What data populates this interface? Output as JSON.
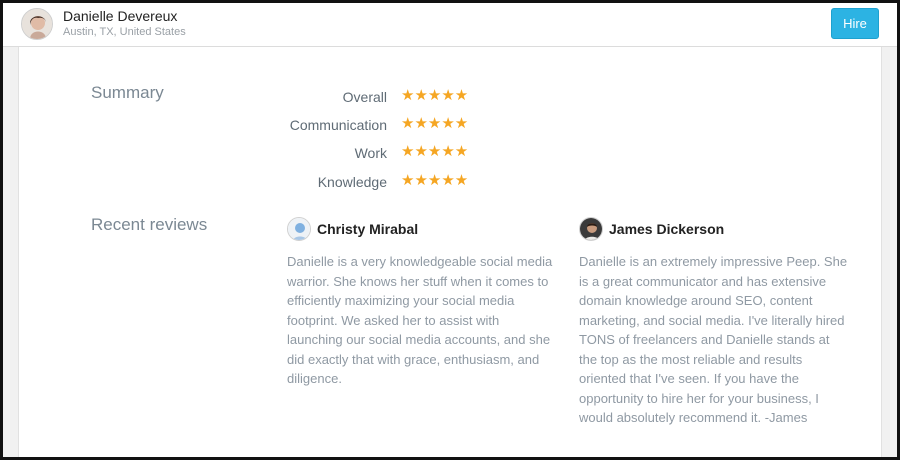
{
  "header": {
    "name": "Danielle Devereux",
    "location": "Austin, TX, United States",
    "hire_label": "Hire"
  },
  "summary": {
    "title": "Summary",
    "ratings": [
      {
        "label": "Overall",
        "stars": 5
      },
      {
        "label": "Communication",
        "stars": 5
      },
      {
        "label": "Work",
        "stars": 5
      },
      {
        "label": "Knowledge",
        "stars": 5
      }
    ],
    "star_glyph": "★★★★★",
    "star_color": "#f5a623"
  },
  "reviews": {
    "title": "Recent reviews",
    "items": [
      {
        "reviewer": "Christy Mirabal",
        "avatar_icon": "default-user-icon",
        "text": "Danielle is a very knowledgeable social media warrior. She knows her stuff when it comes to efficiently maximizing your social media footprint. We asked her to assist with launching our social media accounts, and she did exactly that with grace, enthusiasm, and diligence."
      },
      {
        "reviewer": "James Dickerson",
        "avatar_icon": "user-photo-icon",
        "text": "Danielle is an extremely impressive Peep. She is a great communicator and has extensive domain knowledge around SEO, content marketing, and social media. I've literally hired TONS of freelancers and Danielle stands at the top as the most reliable and results oriented that I've seen. If you have the opportunity to hire her for your business, I would absolutely recommend it. -James"
      }
    ]
  },
  "colors": {
    "accent": "#2cb3e3",
    "heading": "#7b8893",
    "body_text": "#8f99a3"
  }
}
